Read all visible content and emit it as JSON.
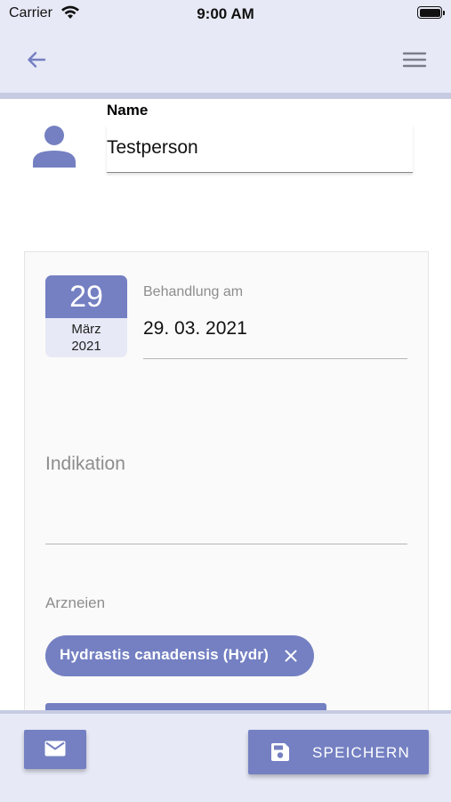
{
  "status_bar": {
    "carrier": "Carrier",
    "time": "9:00 AM",
    "battery_level": 1.0
  },
  "app_bar": {
    "back_icon": "arrow-left-icon",
    "menu_icon": "hamburger-menu-icon",
    "background": "#e7e9f6",
    "icon_color": "#7480c2"
  },
  "patient": {
    "icon": "person-icon",
    "name_label": "Name",
    "name_value": "Testperson"
  },
  "treatment": {
    "date_badge": {
      "day": "29",
      "month": "März",
      "year": "2021"
    },
    "date_label": "Behandlung am",
    "date_value": "29. 03. 2021",
    "indication_placeholder": "Indikation",
    "indication_value": "",
    "remedies_label": "Arzneien",
    "remedies": [
      {
        "label": "Hydrastis canadensis (Hydr)",
        "remove_icon": "close-icon"
      }
    ]
  },
  "bottom_bar": {
    "mail_icon": "mail-icon",
    "save_icon": "save-icon",
    "save_label": "SPEICHERN"
  },
  "colors": {
    "accent": "#7480c2",
    "surface": "#e7e9f6",
    "card": "#fbfafa"
  }
}
